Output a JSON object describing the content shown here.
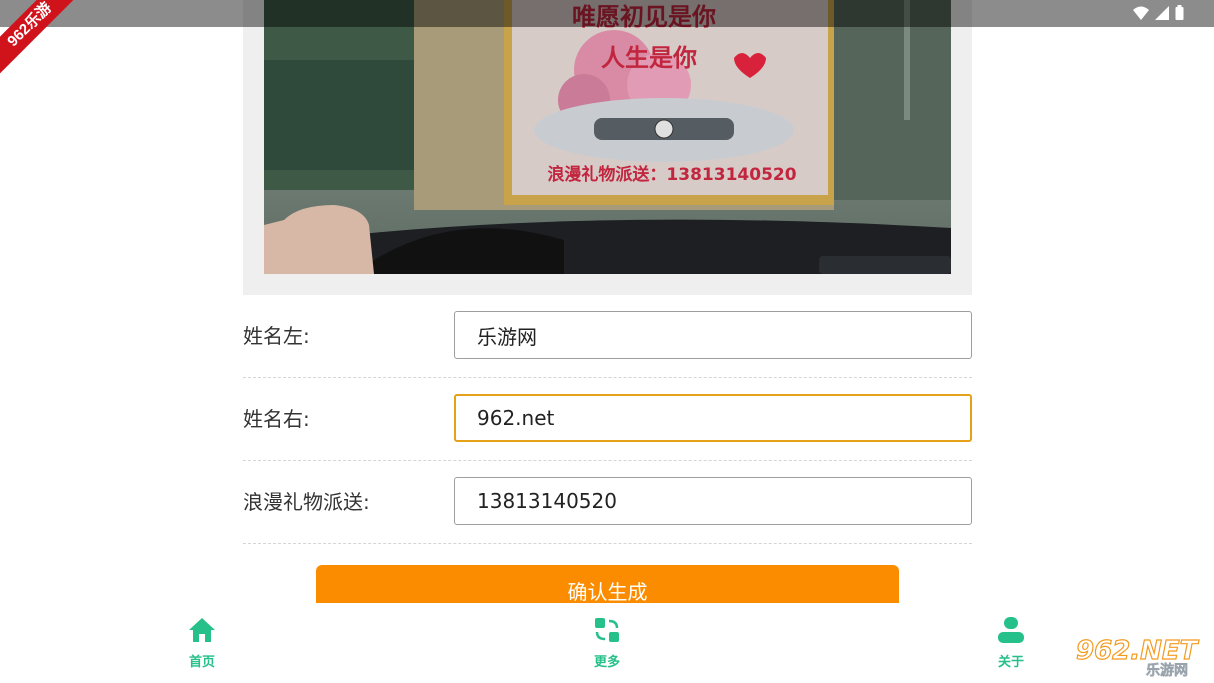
{
  "watermark_ribbon": "962乐游",
  "preview": {
    "banner_line1": "唯愿初见是你",
    "banner_line2": "人生是你",
    "banner_footer": "浪漫礼物派送：13813140520"
  },
  "form": {
    "rows": [
      {
        "label": "姓名左:",
        "value": "乐游网"
      },
      {
        "label": "姓名右:",
        "value": "962.net"
      },
      {
        "label": "浪漫礼物派送:",
        "value": "13813140520"
      }
    ],
    "confirm_label": "确认生成"
  },
  "nav": {
    "items": [
      {
        "label": "首页",
        "icon": "home-icon"
      },
      {
        "label": "更多",
        "icon": "swap-icon"
      },
      {
        "label": "关于",
        "icon": "person-icon"
      }
    ]
  },
  "site_watermark": {
    "main": "962.NET",
    "sub": "乐游网"
  },
  "colors": {
    "accent": "#26c08a",
    "button": "#fb8c00",
    "focus": "#e5a11a",
    "ribbon": "#d0121b"
  }
}
